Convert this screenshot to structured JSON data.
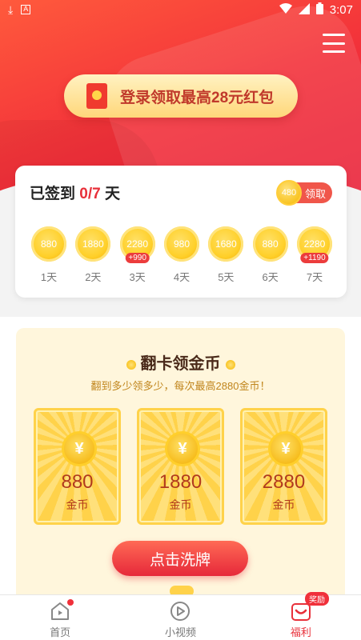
{
  "status_bar": {
    "time": "3:07"
  },
  "banner": {
    "login_text": "登录领取最高28元红包"
  },
  "signin": {
    "title_prefix": "已签到 ",
    "progress": "0/7",
    "title_suffix": " 天",
    "claim_coin": "480",
    "claim_label": "领取",
    "days": [
      {
        "coins": "880",
        "label": "1天",
        "bonus": ""
      },
      {
        "coins": "1880",
        "label": "2天",
        "bonus": ""
      },
      {
        "coins": "2280",
        "label": "3天",
        "bonus": "+990"
      },
      {
        "coins": "980",
        "label": "4天",
        "bonus": ""
      },
      {
        "coins": "1680",
        "label": "5天",
        "bonus": ""
      },
      {
        "coins": "880",
        "label": "6天",
        "bonus": ""
      },
      {
        "coins": "2280",
        "label": "7天",
        "bonus": "+1190"
      }
    ]
  },
  "flip": {
    "heading": "翻卡领金币",
    "subtitle": "翻到多少领多少，每次最高2880金币！",
    "cards": [
      {
        "symbol": "¥",
        "value": "880",
        "unit": "金币"
      },
      {
        "symbol": "¥",
        "value": "1880",
        "unit": "金币"
      },
      {
        "symbol": "¥",
        "value": "2880",
        "unit": "金币"
      }
    ],
    "shuffle_label": "点击洗牌"
  },
  "bottom_nav": {
    "items": [
      {
        "label": "首页",
        "icon": "home-play-icon"
      },
      {
        "label": "小视频",
        "icon": "video-play-icon"
      },
      {
        "label": "福利",
        "icon": "gift-heart-icon"
      }
    ],
    "reward_badge": "奖励"
  },
  "colors": {
    "accent": "#e8303a",
    "gold": "#ffd02a"
  }
}
